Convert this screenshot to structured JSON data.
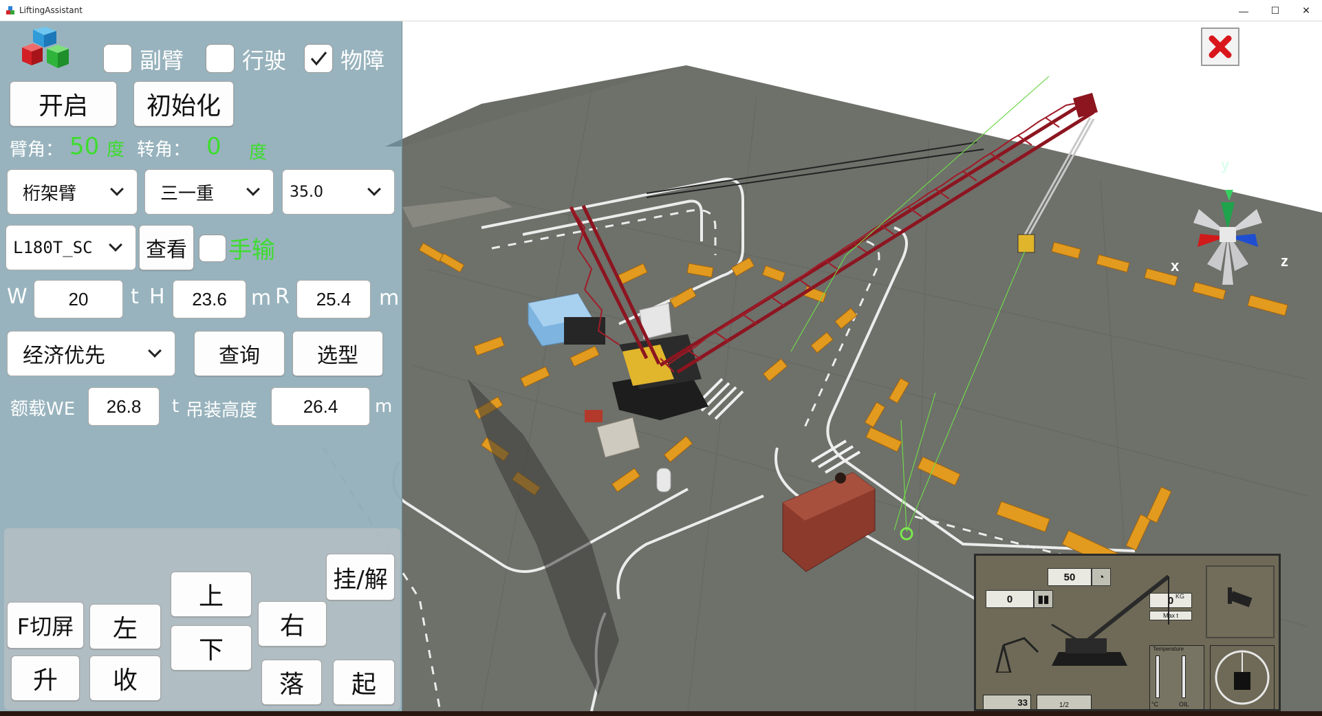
{
  "window": {
    "title": "LiftingAssistant",
    "minimize": "—",
    "maximize": "☐",
    "close": "✕"
  },
  "options": {
    "jib_label": "副臂",
    "jib_checked": false,
    "travel_label": "行驶",
    "travel_checked": false,
    "obstacle_label": "物障",
    "obstacle_checked": true
  },
  "actions": {
    "start": "开启",
    "init": "初始化"
  },
  "angles": {
    "boom_label": "臂角：",
    "boom_value": "50",
    "boom_unit": "度",
    "turn_label": "转角：",
    "turn_value": "0",
    "turn_unit": "度"
  },
  "selectors": {
    "boom_type": "桁架臂",
    "maker": "三一重",
    "length": "35.0",
    "model": "L180T_SC"
  },
  "view_button": "查看",
  "manual": {
    "label": "手输",
    "checked": false
  },
  "params": {
    "w_label": "W",
    "w_value": "20",
    "w_unit": "t",
    "h_label": "H",
    "h_value": "23.6",
    "h_unit": "m",
    "r_label": "R",
    "r_value": "25.4",
    "r_unit": "m"
  },
  "strategy": "经济优先",
  "query_button": "查询",
  "select_button": "选型",
  "result": {
    "rated_label": "额载WE",
    "rated_value": "26.8",
    "rated_unit": "t",
    "height_label": "吊装高度",
    "height_value": "26.4",
    "height_unit": "m"
  },
  "controls": {
    "hook": "挂/解",
    "up": "上",
    "down": "下",
    "left": "左",
    "right": "右",
    "switch_screen": "F切屏",
    "raise": "升",
    "retract": "收",
    "lower": "落",
    "lift": "起"
  },
  "axes": {
    "x": "x",
    "y": "y",
    "z": "z"
  },
  "hud": {
    "angle": "50",
    "rotation": "0",
    "load": "0",
    "load_unit": "KG",
    "max_label": "Max t",
    "temp_label": "Temperature",
    "temp_c": "°C",
    "temp_oil": "OIL",
    "speed": "33",
    "gear": "1/2"
  },
  "colors": {
    "panel": "#7096a4",
    "value_green": "#3edc2e",
    "crane_red": "#8c1520",
    "ground": "#6f716b",
    "barrier_orange": "#e29a1f"
  }
}
